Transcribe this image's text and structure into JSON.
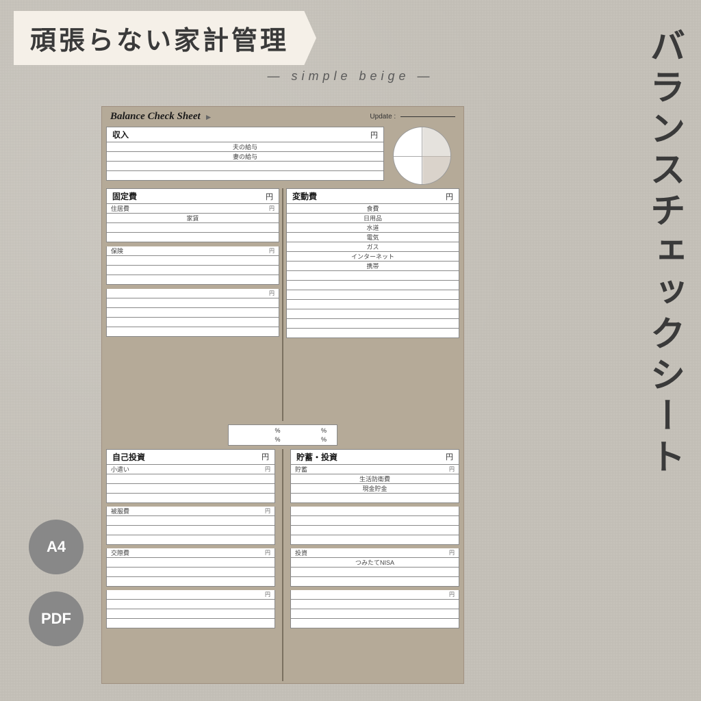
{
  "page": {
    "bg_color": "#c4bfb7",
    "main_title": "頑張らない家計管理",
    "subtitle": "― simple beige ―",
    "vertical_title": "バランスチェックシート",
    "badge_a4": "A4",
    "badge_pdf": "PDF"
  },
  "document": {
    "title": "Balance Check Sheet",
    "update_label": "Update :",
    "income_section": {
      "title": "収入",
      "unit": "円",
      "rows": [
        "夫の給与",
        "妻の給与"
      ]
    },
    "fixed_section": {
      "title": "固定費",
      "unit": "円",
      "sub_sections": [
        {
          "label": "住居費",
          "unit": "円",
          "rows": [
            "家賃",
            "",
            ""
          ]
        },
        {
          "label": "保険",
          "unit": "円",
          "rows": [
            "",
            "",
            ""
          ]
        },
        {
          "label": "",
          "unit": "円",
          "rows": [
            "",
            "",
            ""
          ]
        }
      ]
    },
    "variable_section": {
      "title": "変動費",
      "unit": "円",
      "rows": [
        "食費",
        "日用品",
        "水道",
        "電気",
        "ガス",
        "インターネット",
        "携帯",
        "",
        "",
        "",
        "",
        ""
      ]
    },
    "ratio_section": {
      "cells": [
        "%",
        "%",
        "%",
        "%"
      ]
    },
    "self_invest_section": {
      "title": "自己投資",
      "unit": "円",
      "sub_sections": [
        {
          "label": "小遣い",
          "unit": "円",
          "rows": [
            "",
            "",
            ""
          ]
        },
        {
          "label": "被服費",
          "unit": "円",
          "rows": [
            "",
            "",
            ""
          ]
        },
        {
          "label": "交際費",
          "unit": "円",
          "rows": [
            "",
            "",
            ""
          ]
        },
        {
          "label": "",
          "unit": "円",
          "rows": [
            "",
            "",
            ""
          ]
        }
      ]
    },
    "savings_section": {
      "title": "貯蓄・投資",
      "unit": "円",
      "sub_sections": [
        {
          "label": "貯蓄",
          "unit": "円",
          "rows": [
            "生活防衛費",
            "現金貯金",
            ""
          ]
        },
        {
          "label": "",
          "unit": "",
          "rows": [
            "",
            "",
            ""
          ]
        },
        {
          "label": "投資",
          "unit": "円",
          "rows": [
            "つみたてNISA",
            "",
            ""
          ]
        },
        {
          "label": "",
          "unit": "円",
          "rows": [
            "",
            "",
            ""
          ]
        }
      ]
    }
  }
}
